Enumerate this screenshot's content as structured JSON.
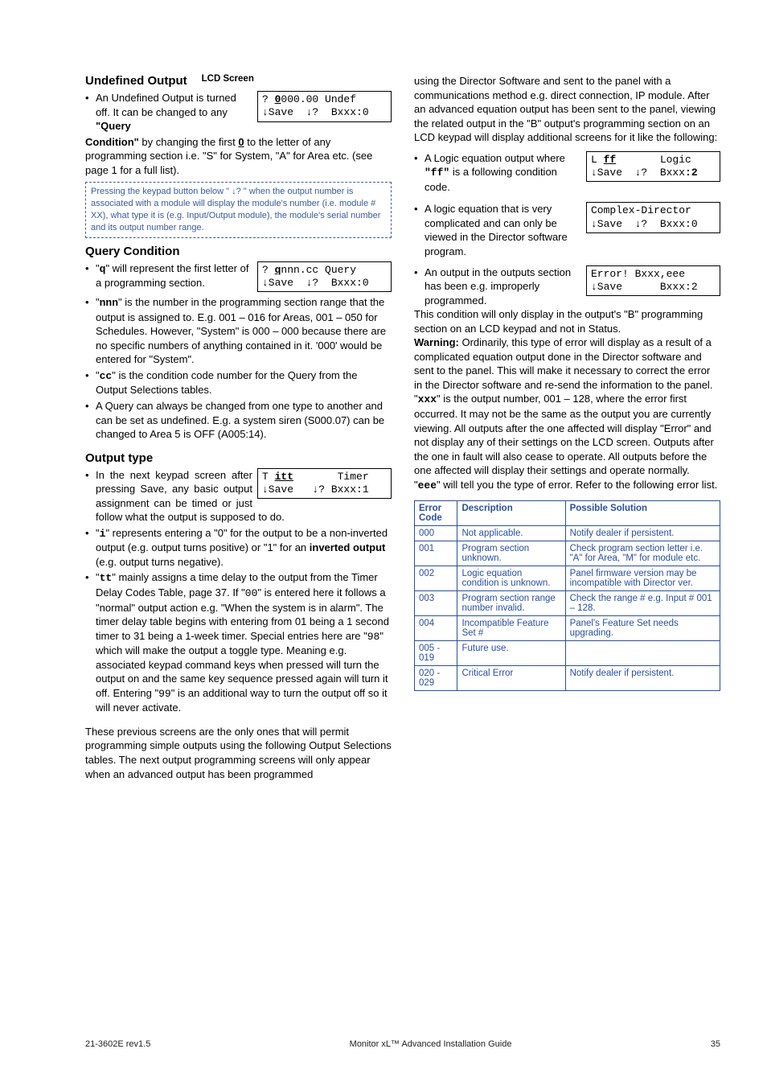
{
  "left": {
    "undef_heading": "Undefined Output",
    "lcd_screen_label": "LCD Screen",
    "lcd_undef_l1": "? 0000.00 Undef",
    "lcd_undef_l2": "↓Save  ↓?  Bxxx:0",
    "undef_li1_a": "An Undefined Output is turned off. It can be changed to any ",
    "undef_li1_b": "\"Query ",
    "undef_para_a": "Condition\"",
    "undef_para_b": " by changing the first ",
    "undef_para_c": "0",
    "undef_para_d": " to the letter of any programming section i.e. \"S\" for System, \"A\" for Area etc. (see page 1 for a full list).",
    "dashed": "Pressing the keypad button below \" ↓? \" when the output number is associated with a module will display the module's number (i.e. module # XX), what type it is (e.g. Input/Output module), the module's serial number and its output number range.",
    "query_heading": "Query Condition",
    "lcd_query_l1": "? qnnn.cc Query",
    "lcd_query_l2": "↓Save  ↓?  Bxxx:0",
    "q_li1_a": "\"",
    "q_li1_b": "q",
    "q_li1_c": "\" will represent  the first letter of a programming section.",
    "q_li2_a": "\"",
    "q_li2_b": "nnn",
    "q_li2_c": "\" is the number in the programming section range that the output is assigned to. E.g. 001 – 016 for Areas, 001 – 050 for Schedules. However, \"System\" is 000 – 000 because there are no specific numbers of anything contained in it. '000' would be entered for \"System\".",
    "q_li3_a": "\"",
    "q_li3_b": "cc",
    "q_li3_c": "\" is the condition code number for the Query from the Output Selections tables.",
    "q_li4": "A Query can always be changed from one type to another and can be set as undefined. E.g. a system siren (S000.07) can be changed to Area 5 is OFF (A005:14).",
    "out_heading": "Output type",
    "lcd_out_l1": "T itt       Timer",
    "lcd_out_l2": "↓Save   ↓? Bxxx:1",
    "o_li1": "In the next keypad screen after pressing Save, any basic output assignment can be timed or just follow what the output is supposed to do.",
    "o_li2_a": "\"",
    "o_li2_b": "i",
    "o_li2_c": "\" represents entering a \"0\"  for the output to be a non-inverted output (e.g. output turns positive) or \"1\" for an ",
    "o_li2_d": "inverted output",
    "o_li2_e": " (e.g. output turns negative).",
    "o_li3_a": "\"",
    "o_li3_b": "tt",
    "o_li3_c": "\" mainly assigns a time delay to the output from the Timer Delay Codes Table, page 37. If \"",
    "o_li3_d": "00",
    "o_li3_e": "\" is entered here it follows a \"normal\" output action e.g. \"When the system is in alarm\". The timer delay table begins with entering from 01 being a 1 second timer to 31 being a 1-week timer. Special entries here are \"",
    "o_li3_f": "98",
    "o_li3_g": "\" which will make the output a toggle type. Meaning e.g. associated keypad command keys when pressed will turn the output on and the same key sequence pressed again will turn it off. Entering \"",
    "o_li3_h": "99",
    "o_li3_i": "\" is an additional way to turn the output off so it will never activate.",
    "o_para_final": "These previous screens are the only ones that will permit programming simple outputs using the following Output Selections tables. The next output programming screens will only appear when an advanced output has been programmed"
  },
  "right": {
    "intro": "using the Director Software and sent to the panel with a communications method e.g. direct connection, IP module. After an advanced equation output has been sent to the panel, viewing the related output in the \"B\" output's programming section on an LCD keypad will display additional screens for it like the following:",
    "lcd_logic_l1": "L ff       Logic",
    "lcd_logic_l2": "↓Save  ↓?  Bxxx:2",
    "r_li1_a": "A Logic equation output where ",
    "r_li1_b": "\"ff\"",
    "r_li1_c": " is a following condition code.",
    "lcd_complex_l1": "Complex-Director",
    "lcd_complex_l2": "↓Save  ↓?  Bxxx:0",
    "r_li2": "A logic equation that is very complicated and can only be viewed in the Director software program.",
    "lcd_err_l1": "Error! Bxxx,eee",
    "lcd_err_l2": "↓Save      Bxxx:2",
    "r_li3_a": "An output in the outputs section has been e.g. improperly programmed.",
    "r_li3_b": "This condition will only display in the output's \"B\" programming section on an LCD keypad and not in Status.",
    "r_li3_c_label": "Warning:",
    "r_li3_c": " Ordinarily, this type of error will display as a result of a complicated equation output done in the Director software and sent to the panel. This will make it necessary to correct the error in the Director software and re-send the information to the panel.",
    "r_li3_d_a": "\"",
    "r_li3_d_b": "xxx",
    "r_li3_d_c": "\" is the output number, 001 – 128, where the error first occurred. It may not be the same as the output you are currently viewing. All outputs after the one affected will display \"Error\" and not display any of their settings on the LCD screen. Outputs after the one in fault will also cease to operate. All outputs before the one affected will display their settings and operate normally.",
    "r_li3_e_a": "\"",
    "r_li3_e_b": "eee",
    "r_li3_e_c": "\" will tell you the type of error. Refer to the following error list.",
    "table_head": [
      "Error Code",
      "Description",
      "Possible Solution"
    ],
    "table_rows": [
      [
        "000",
        "Not applicable.",
        "Notify dealer if persistent."
      ],
      [
        "001",
        "Program section unknown.",
        "Check program section letter i.e. \"A\" for Area, \"M\" for module etc."
      ],
      [
        "002",
        "Logic equation condition is unknown.",
        "Panel firmware version may be incompatible with Director ver."
      ],
      [
        "003",
        "Program section range number invalid.",
        "Check the range # e.g. Input # 001 – 128."
      ],
      [
        "004",
        "Incompatible Feature Set #",
        "Panel's Feature Set needs upgrading."
      ],
      [
        "005 - 019",
        "Future use.",
        ""
      ],
      [
        "020 - 029",
        "Critical Error",
        "Notify dealer if persistent."
      ]
    ]
  },
  "footer": {
    "left": "21-3602E rev1.5",
    "center": "Monitor xL™ Advanced Installation Guide",
    "right": "35"
  }
}
